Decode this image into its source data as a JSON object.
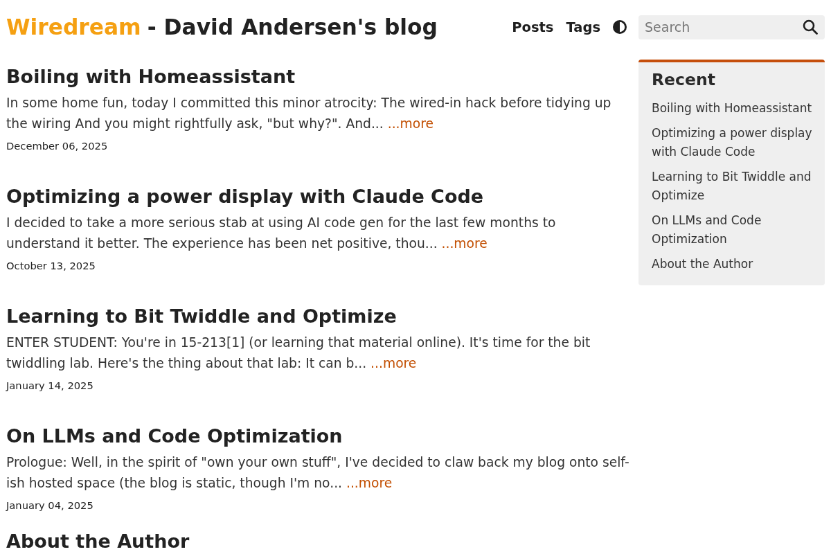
{
  "header": {
    "site_name": "Wiredream",
    "title": "- David Andersen's blog",
    "nav": [
      {
        "label": "Posts"
      },
      {
        "label": "Tags"
      }
    ],
    "search": {
      "placeholder": "Search"
    }
  },
  "posts": [
    {
      "title": "Boiling with Homeassistant",
      "excerpt": "In some home fun, today I committed this minor atrocity: The wired-in hack before tidying up the wiring And you might rightfully ask, \"but why?\". And...",
      "more": "...more",
      "date": "December 06, 2025"
    },
    {
      "title": "Optimizing a power display with Claude Code",
      "excerpt": "I decided to take a more serious stab at using AI code gen for the last few months to understand it better. The experience has been net positive, thou...",
      "more": "...more",
      "date": "October 13, 2025"
    },
    {
      "title": "Learning to Bit Twiddle and Optimize",
      "excerpt": "ENTER STUDENT: You're in 15-213[1] (or learning that material online). It's time for the bit twiddling lab. Here's the thing about that lab: It can b...",
      "more": "...more",
      "date": "January 14, 2025"
    },
    {
      "title": "On LLMs and Code Optimization",
      "excerpt": "Prologue: Well, in the spirit of \"own your own stuff\", I've decided to claw back my blog onto self-ish hosted space (the blog is static, though I'm no...",
      "more": "...more",
      "date": "January 04, 2025"
    },
    {
      "title": "About the Author"
    }
  ],
  "sidebar": {
    "heading": "Recent",
    "items": [
      "Boiling with Homeassistant",
      "Optimizing a power display with Claude Code",
      "Learning to Bit Twiddle and Optimize",
      "On LLMs and Code Optimization",
      "About the Author"
    ]
  }
}
